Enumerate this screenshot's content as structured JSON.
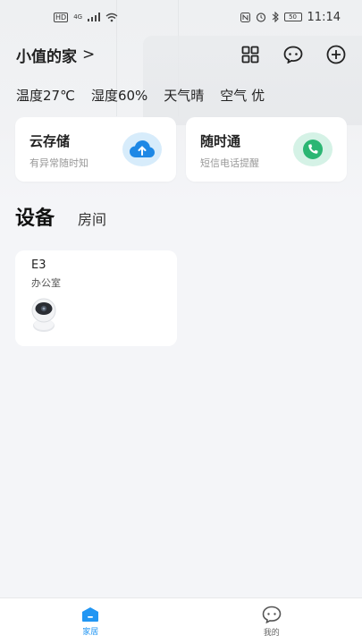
{
  "status_bar": {
    "left_badge": "HD",
    "network": "4G",
    "battery": "50",
    "time": "11:14"
  },
  "header": {
    "home_name": "小值的家",
    "chevron": ">"
  },
  "weather": {
    "temperature": "温度27℃",
    "humidity": "湿度60%",
    "condition": "天气晴",
    "air": "空气 优"
  },
  "services": [
    {
      "title": "云存储",
      "subtitle": "有异常随时知",
      "icon": "cloud-upload-icon",
      "color": "#1e88e5"
    },
    {
      "title": "随时通",
      "subtitle": "短信电话提醒",
      "icon": "phone-icon",
      "color": "#2bb673"
    }
  ],
  "tabs": {
    "devices": "设备",
    "rooms": "房间"
  },
  "devices": [
    {
      "name": "E3",
      "room": "办公室",
      "icon": "camera-icon"
    }
  ],
  "bottom_nav": [
    {
      "label": "家居",
      "icon": "home-icon",
      "active": true
    },
    {
      "label": "我的",
      "icon": "profile-icon",
      "active": false
    }
  ],
  "colors": {
    "accent": "#2196f3",
    "background": "#f4f5f8"
  }
}
